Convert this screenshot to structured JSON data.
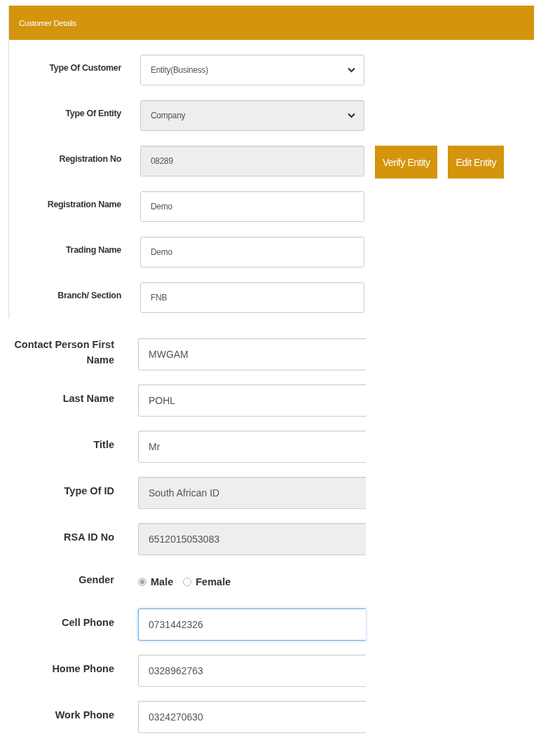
{
  "panel": {
    "title": "Customer Details",
    "fields": [
      {
        "label": "Type Of Customer",
        "kind": "select",
        "value": "Entity(Business)",
        "disabled": false
      },
      {
        "label": "Type Of Entity",
        "kind": "select",
        "value": "Company",
        "disabled": true
      },
      {
        "label": "Registration No",
        "kind": "text",
        "value": "08289",
        "disabled": true,
        "actions": [
          "Verify Entity",
          "Edit Entity"
        ]
      },
      {
        "label": "Registration Name",
        "kind": "text",
        "value": "Demo",
        "disabled": false
      },
      {
        "label": "Trading Name",
        "kind": "text",
        "value": "Demo",
        "disabled": false
      },
      {
        "label": "Branch/ Section",
        "kind": "text",
        "value": "FNB",
        "disabled": false
      }
    ]
  },
  "contact": {
    "fields": [
      {
        "label": "Contact Person First Name",
        "kind": "text",
        "value": "MWGAM",
        "disabled": false,
        "focused": false
      },
      {
        "label": "Last Name",
        "kind": "text",
        "value": "POHL",
        "disabled": false,
        "focused": false
      },
      {
        "label": "Title",
        "kind": "text",
        "value": "Mr",
        "disabled": false,
        "focused": false
      },
      {
        "label": "Type Of ID",
        "kind": "text",
        "value": "South African ID",
        "disabled": true,
        "focused": false
      },
      {
        "label": "RSA ID No",
        "kind": "text",
        "value": "6512015053083",
        "disabled": true,
        "focused": false
      },
      {
        "label": "Gender",
        "kind": "radio",
        "disabled": true,
        "options": [
          {
            "label": "Male",
            "selected": true
          },
          {
            "label": "Female",
            "selected": false
          }
        ]
      },
      {
        "label": "Cell Phone",
        "kind": "text",
        "value": "0731442326",
        "disabled": false,
        "focused": true
      },
      {
        "label": "Home Phone",
        "kind": "text",
        "value": "0328962763",
        "disabled": false,
        "focused": false
      },
      {
        "label": "Work Phone",
        "kind": "text",
        "value": "0324270630",
        "disabled": false,
        "focused": false
      }
    ]
  }
}
